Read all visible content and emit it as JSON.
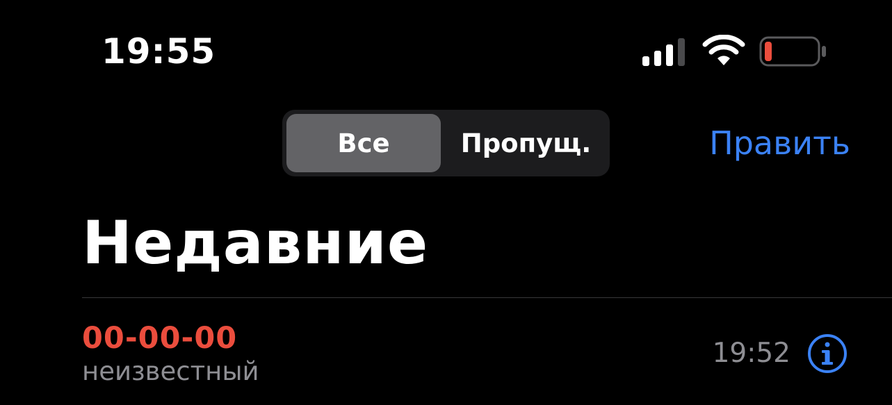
{
  "status_bar": {
    "time": "19:55",
    "icons": [
      "signal-icon",
      "wifi-icon",
      "battery-icon"
    ],
    "battery_color": "#eb4d3d"
  },
  "header": {
    "segments": [
      {
        "label": "Все",
        "selected": true
      },
      {
        "label": "Пропущ.",
        "selected": false
      }
    ],
    "edit_label": "Править",
    "accent_color": "#3b82f6"
  },
  "page": {
    "title": "Недавние"
  },
  "calls": [
    {
      "number": "00-00-00",
      "label": "неизвестный",
      "time": "19:52",
      "missed": true,
      "missed_color": "#eb4d3d",
      "info_icon": "info-icon"
    }
  ]
}
